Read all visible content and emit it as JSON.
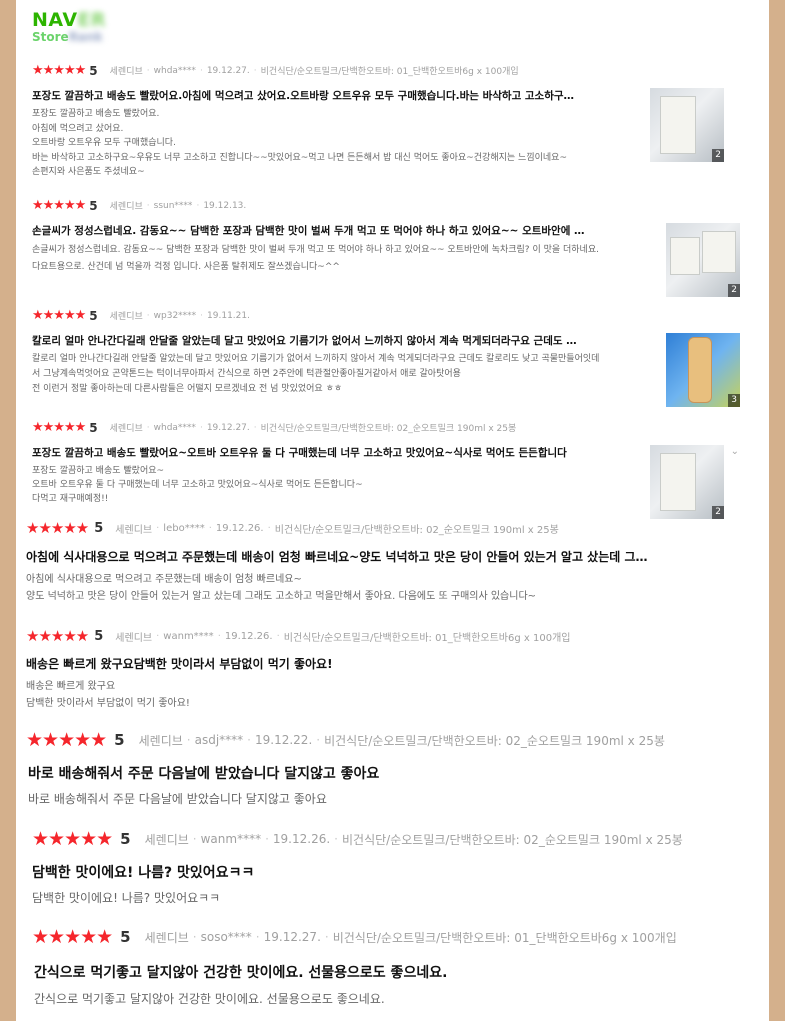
{
  "logo": {
    "brand_visible": "NAV",
    "brand_blurred": "ER",
    "sub_visible": "Store",
    "sub_blurred": "Rank"
  },
  "reviews": [
    {
      "stars": "★★★★★",
      "score": "5",
      "user_type": "세렌디브",
      "user": "whda****",
      "date": "19.12.27.",
      "option": "비건식단/순오트밀크/단백한오트바: 01_단백한오트바6g x 100개입",
      "title": "포장도 깔끔하고 배송도 빨랐어요.아침에 먹으려고 샀어요.오트바랑 오트우유 모두 구매했습니다.바는 바삭하고 고소하구…",
      "body": [
        "포장도 깔끔하고 배송도 빨랐어요.",
        "아침에 먹으려고 샀어요.",
        "오트바랑 오트우유 모두 구매했습니다.",
        "바는 바삭하고 고소하구요~우유도 너무 고소하고 진합니다~~맛있어요~먹고 나면 든든해서 밥 대신 먹어도 좋아요~건강해지는 느낌이네요~",
        "손편지와 사은품도 주셨네요~"
      ],
      "photo_count": "2"
    },
    {
      "stars": "★★★★★",
      "score": "5",
      "user_type": "세렌디브",
      "user": "ssun****",
      "date": "19.12.13.",
      "option": "",
      "title": "손글씨가 정성스럽네요. 감동요~~ 담백한 포장과 담백한 맛이 벌써 두개 먹고 또 먹어야 하나 하고 있어요~~ 오트바안에 …",
      "body": [
        "손글씨가 정성스럽네요. 감동요~~ 담백한 포장과 담백한 맛이 벌써 두개 먹고 또 먹어야 하나 하고 있어요~~ 오트바안에 녹차크림? 이 맛을 더하네요.",
        "다요트용으로. 산건데 넘 먹을까 걱정 입니다. 사은품 탈취제도 잘쓰겠습니다~^^"
      ],
      "photo_count": "2"
    },
    {
      "stars": "★★★★★",
      "score": "5",
      "user_type": "세렌디브",
      "user": "wp32****",
      "date": "19.11.21.",
      "option": "",
      "title": "칼로리 얼마 안나간다길래 안달줄 알았는데 달고 맛있어요 기름기가 없어서 느끼하지 않아서 계속 먹게되더라구요 근데도 …",
      "body": [
        "칼로리 얼마 안나간다길래 안달줄 알았는데 달고 맛있어요 기름기가 없어서 느끼하지 않아서 계속 먹게되더라구요 근데도 칼로리도 낮고 곡물만들어잇데",
        "서 그냥계속먹엇어요 곤약톤드는 턱이너무아파서 간식으로 하면 2주안에 턱관절안좋아질거같아서 애로 갈아탓어용",
        "전 이런거 정말 좋아하는데 다른사람들은 어떨지 모르겠네요 전 넘 맛있었어요 ㅎㅎ"
      ],
      "photo_count": "3"
    },
    {
      "stars": "★★★★★",
      "score": "5",
      "user_type": "세렌디브",
      "user": "whda****",
      "date": "19.12.27.",
      "option": "비건식단/순오트밀크/단백한오트바: 02_순오트밀크 190ml x 25봉",
      "title": "포장도 깔끔하고 배송도 빨랐어요~오트바 오트우유 둘 다 구매했는데 너무 고소하고 맛있어요~식사로 먹어도 든든합니다",
      "body": [
        "포장도 깔끔하고 배송도 빨랐어요~",
        "오트바 오트우유 둘 다 구매했는데 너무 고소하고 맛있어요~식사로 먹어도 든든합니다~",
        "다먹고 재구매예정!!"
      ],
      "photo_count": "2"
    },
    {
      "stars": "★★★★★",
      "score": "5",
      "user_type": "세렌디브",
      "user": "lebo****",
      "date": "19.12.26.",
      "option": "비건식단/순오트밀크/단백한오트바: 02_순오트밀크 190ml x 25봉",
      "title": "아침에 식사대용으로 먹으려고 주문했는데 배송이 엄청 빠르네요~양도 넉넉하고 맛은 당이 안들어 있는거 알고 샀는데 그…",
      "body": [
        "아침에 식사대용으로 먹으려고 주문했는데 배송이 엄청 빠르네요~",
        "양도 넉넉하고 맛은 당이 안들어 있는거 알고 샀는데 그래도 고소하고 먹을만해서 좋아요. 다음에도 또 구매의사 있습니다~"
      ]
    },
    {
      "stars": "★★★★★",
      "score": "5",
      "user_type": "세렌디브",
      "user": "wanm****",
      "date": "19.12.26.",
      "option": "비건식단/순오트밀크/단백한오트바: 01_단백한오트바6g x 100개입",
      "title": "배송은 빠르게 왔구요담백한 맛이라서 부담없이 먹기 좋아요!",
      "body": [
        "배송은 빠르게 왔구요",
        "담백한 맛이라서 부담없이 먹기 좋아요!"
      ]
    },
    {
      "stars": "★★★★★",
      "score": "5",
      "user_type": "세렌디브",
      "user": "asdj****",
      "date": "19.12.22.",
      "option": "비건식단/순오트밀크/단백한오트바: 02_순오트밀크 190ml x 25봉",
      "title": "바로 배송해줘서 주문 다음날에 받았습니다 달지않고 좋아요",
      "body": [
        "바로 배송해줘서 주문 다음날에 받았습니다 달지않고 좋아요"
      ]
    },
    {
      "stars": "★★★★★",
      "score": "5",
      "user_type": "세렌디브",
      "user": "wanm****",
      "date": "19.12.26.",
      "option": "비건식단/순오트밀크/단백한오트바: 02_순오트밀크 190ml x 25봉",
      "title": "담백한 맛이에요! 나름? 맛있어요ㅋㅋ",
      "body": [
        "담백한 맛이에요! 나름? 맛있어요ㅋㅋ"
      ]
    },
    {
      "stars": "★★★★★",
      "score": "5",
      "user_type": "세렌디브",
      "user": "soso****",
      "date": "19.12.27.",
      "option": "비건식단/순오트밀크/단백한오트바: 01_단백한오트바6g x 100개입",
      "title": "간식으로 먹기좋고 달지않아 건강한 맛이에요. 선물용으로도 좋으네요.",
      "body": [
        "간식으로 먹기좋고 달지않아 건강한 맛이에요. 선물용으로도 좋으네요."
      ]
    }
  ]
}
